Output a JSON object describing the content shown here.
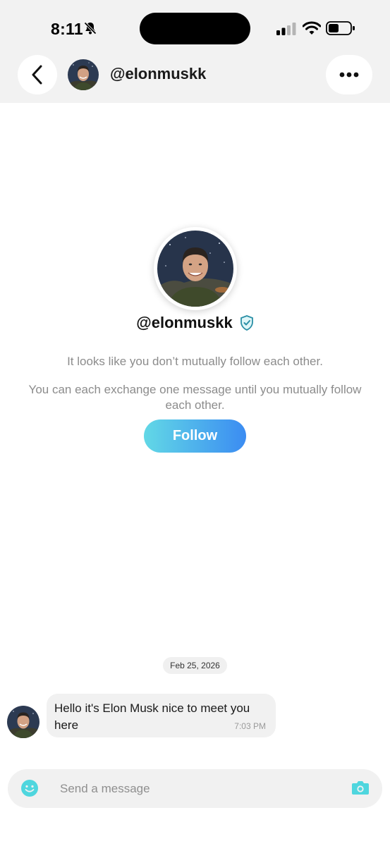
{
  "status_bar": {
    "time": "8:11",
    "icons": [
      "bell-slash-icon",
      "signal-icon",
      "wifi-icon",
      "battery-icon"
    ]
  },
  "header": {
    "back_icon": "chevron-left-icon",
    "username": "@elonmuskk",
    "more_icon": "ellipsis-icon"
  },
  "profile": {
    "username": "@elonmuskk",
    "verified_icon": "verified-shield-icon",
    "notice_line1": "It looks like you don’t mutually follow each other.",
    "notice_line2": "You can each exchange one message until you mutually follow each other.",
    "follow_label": "Follow"
  },
  "chat": {
    "date": "Feb 25, 2026",
    "messages": [
      {
        "text": "Hello it's Elon Musk nice to meet you here",
        "time": "7:03 PM"
      }
    ]
  },
  "composer": {
    "placeholder": "Send a message",
    "emoji_icon": "smiley-icon",
    "camera_icon": "camera-icon"
  },
  "colors": {
    "accent_cyan": "#4fd6de",
    "follow_gradient_start": "#62d8e6",
    "follow_gradient_end": "#3b8cf2",
    "secondary_text": "#8c8c8c"
  }
}
